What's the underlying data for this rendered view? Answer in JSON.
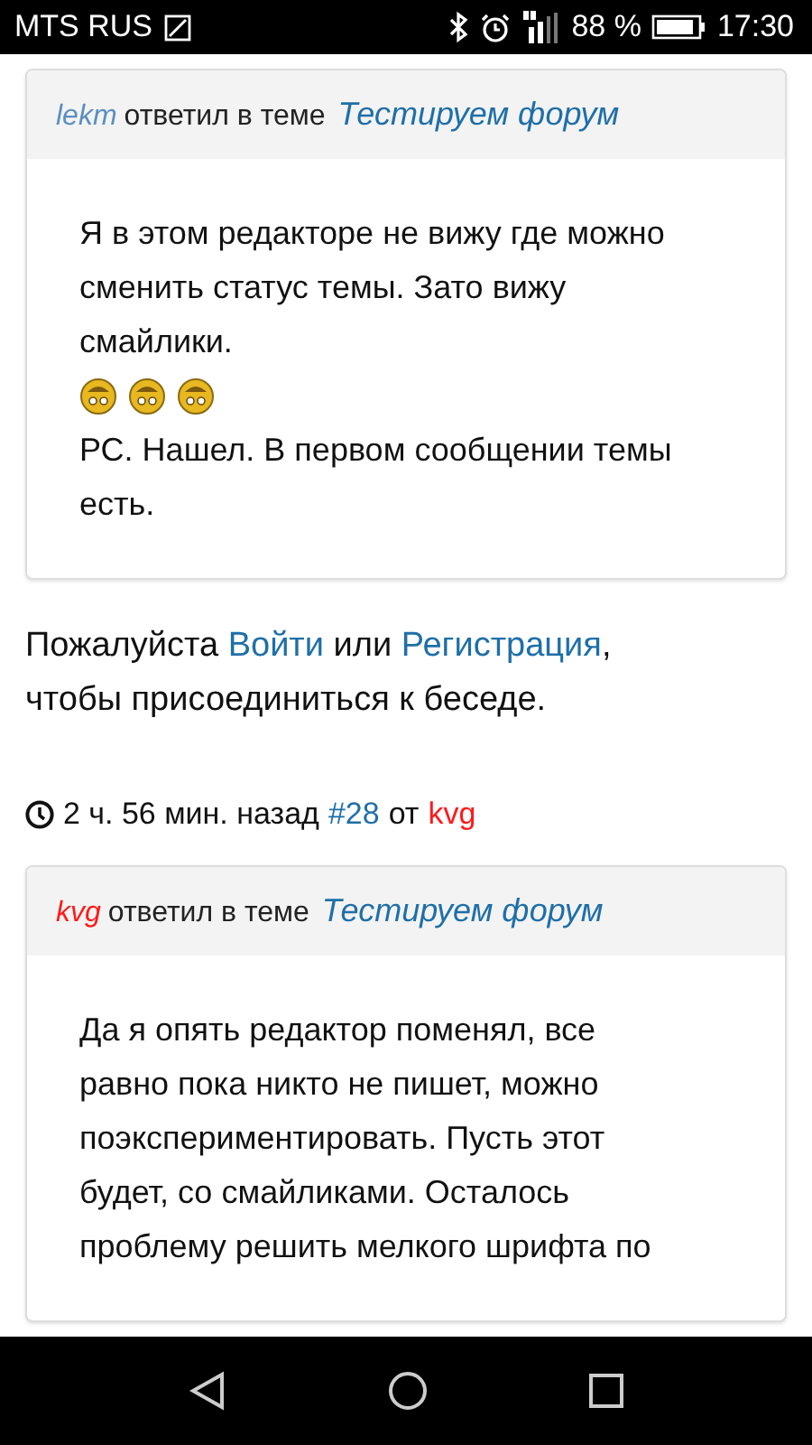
{
  "status_bar": {
    "carrier": "MTS RUS",
    "battery_text": "88 %",
    "time": "17:30"
  },
  "first_post": {
    "author": "lekm",
    "color": "#5b8fc0",
    "action": "ответил в теме",
    "topic": "Тестируем форум",
    "paragraphs": [
      {
        "kind": "text",
        "text": "Я в этом редакторе не вижу где можно сменить статус темы. Зато вижу смайлики."
      },
      {
        "kind": "smileys",
        "smileys": [
          {
            "kind": "grin"
          },
          {
            "kind": "grin"
          },
          {
            "kind": "grin"
          }
        ]
      },
      {
        "kind": "text",
        "text": "РС. Нашел. В первом сообщении темы есть."
      }
    ]
  },
  "login_note": {
    "before": "Пожалуйста ",
    "login": "Войти",
    "middle": " или ",
    "register": "Регистрация",
    "after": ", чтобы присоединиться к беседе."
  },
  "post_meta": {
    "time": "2 ч. 56 мин. назад",
    "number": "#28",
    "by": "от",
    "author": "kvg",
    "color": "#ff1a1a"
  },
  "second_post": {
    "author": "kvg",
    "color": "#ff1a1a",
    "action": "ответил в теме",
    "topic": "Тестируем форум",
    "paragraphs": [
      {
        "kind": "text",
        "text": "Да я опять редактор поменял, все равно пока никто не пишет, можно поэкспериментировать. Пусть этот будет, со смайликами. Осталось проблему решить мелкого шрифта по"
      }
    ]
  }
}
